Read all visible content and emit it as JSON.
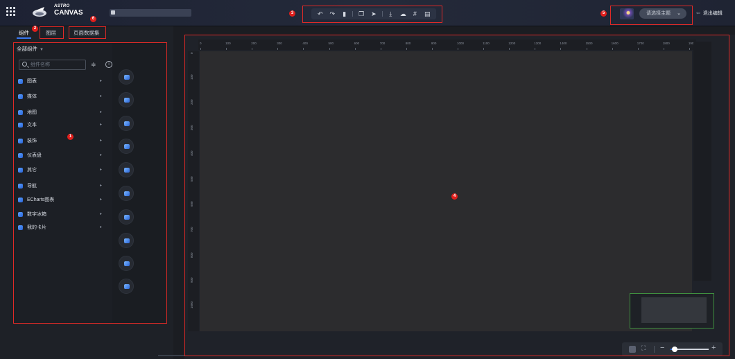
{
  "header": {
    "logo_line1": "ASTRO",
    "logo_line2": "CANVAS",
    "toolbar_icons": [
      "undo-icon",
      "redo-icon",
      "save-icon",
      "copy-icon",
      "publish-icon",
      "download-icon",
      "cloud-icon",
      "grid-icon",
      "export-icon"
    ],
    "theme_placeholder": "请选择主题",
    "exit_label": "退出编辑"
  },
  "sidebar": {
    "tabs": [
      "组件",
      "图层",
      "页面数据集"
    ],
    "all_components": "全部组件",
    "search_placeholder": "组件名称",
    "categories": [
      "图表",
      "媒体",
      "地图",
      "文本",
      "装饰",
      "仪表盘",
      "其它",
      "导航",
      "ECharts图表",
      "数字冰箱",
      "我的卡片"
    ]
  },
  "ruler": {
    "x_ticks": [
      "0",
      "100",
      "200",
      "300",
      "400",
      "500",
      "600",
      "700",
      "800",
      "900",
      "1000",
      "1100",
      "1200",
      "1300",
      "1400",
      "1500",
      "1600",
      "1700",
      "1800",
      "1900"
    ],
    "y_ticks": [
      "0",
      "100",
      "200",
      "300",
      "400",
      "500",
      "600",
      "700",
      "800",
      "900",
      "1000"
    ]
  },
  "annotations": [
    "1",
    "2",
    "3",
    "4",
    "5",
    "6"
  ],
  "colors": {
    "annotation": "#e02a27",
    "accent": "#3a79f2",
    "canvas": "#2c2c2e"
  },
  "zoom": {
    "level_fraction": 0.1
  }
}
